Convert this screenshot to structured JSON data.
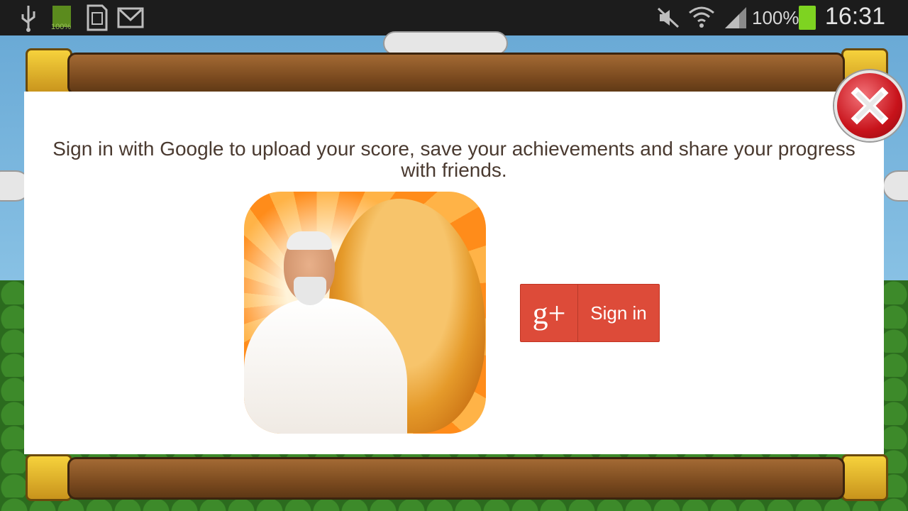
{
  "status_bar": {
    "battery_small_label": "100%",
    "signal_percent": "100%",
    "time": "16:31",
    "icons": [
      "usb-icon",
      "battery-full-icon",
      "sd-card-icon",
      "gmail-icon",
      "mute-icon",
      "wifi-icon",
      "signal-icon",
      "battery-icon"
    ]
  },
  "dialog": {
    "message": "Sign in with Google to upload your score, save your achievements and share your progress with friends.",
    "signin_label": "Sign in",
    "gplus_glyph": "g+",
    "close_icon": "close-icon"
  }
}
